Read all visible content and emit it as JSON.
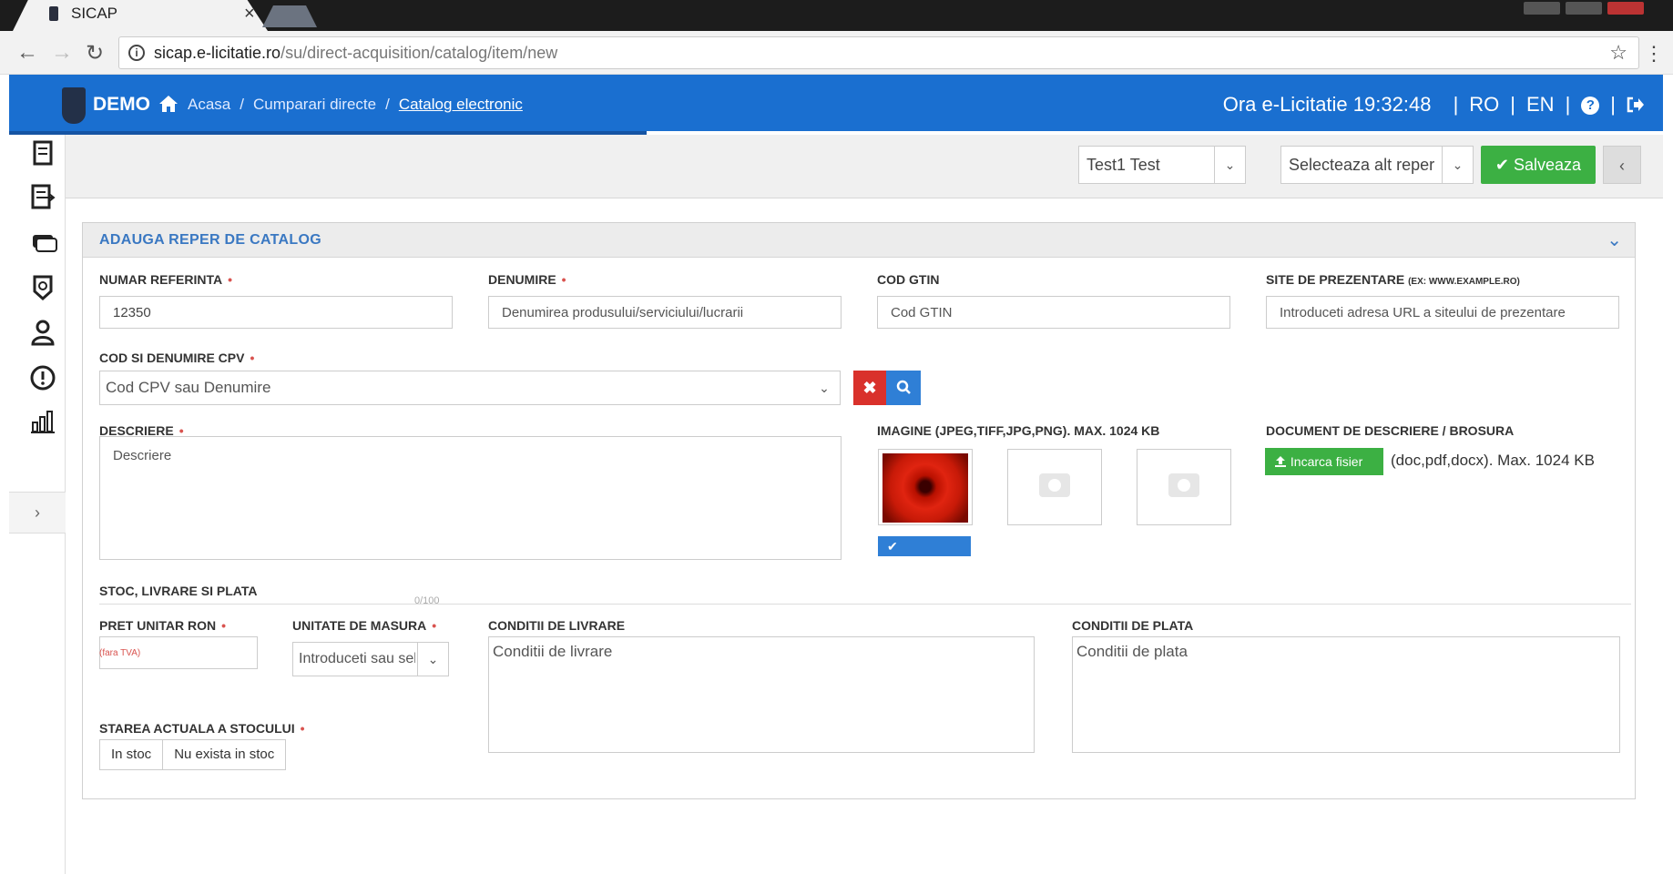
{
  "browser": {
    "tab_title": "SICAP",
    "tab_close": "×",
    "url_host": "sicap.e-licitatie.ro",
    "url_path": "/su/direct-acquisition/catalog/item/new"
  },
  "header": {
    "brand": "DEMO",
    "breadcrumbs": [
      "Acasa",
      "Cumparari directe",
      "Catalog electronic"
    ],
    "breadcrumb_sep": "/",
    "clock_label": "Ora e-Licitatie",
    "clock_time": "19:32:48",
    "lang_ro": "RO",
    "lang_en": "EN",
    "divider": "|",
    "help": "?"
  },
  "toolbar": {
    "user_select": "Test1 Test",
    "reper_select": "Selecteaza alt reper",
    "save_label": "✔ Salveaza",
    "collapse_label": "‹"
  },
  "panel": {
    "title": "ADAUGA REPER DE CATALOG",
    "chevron": "⌄"
  },
  "form": {
    "numar_referinta": {
      "label": "NUMAR REFERINTA",
      "value": "12350"
    },
    "denumire": {
      "label": "DENUMIRE",
      "placeholder": "Denumirea produsului/serviciului/lucrarii"
    },
    "cod_gtin": {
      "label": "COD GTIN",
      "placeholder": "Cod GTIN"
    },
    "site": {
      "label": "SITE DE PREZENTARE",
      "hint": "(EX: WWW.EXAMPLE.RO)",
      "placeholder": "Introduceti adresa URL a siteului de prezentare"
    },
    "cpv": {
      "label": "COD SI DENUMIRE CPV",
      "placeholder": "Cod CPV sau Denumire",
      "clear": "✖"
    },
    "descriere": {
      "label": "DESCRIERE",
      "placeholder": "Descriere"
    },
    "imagine": {
      "label": "IMAGINE (JPEG,TIFF,JPG,PNG). MAX. 1024 KB",
      "check": "✔"
    },
    "document": {
      "label": "DOCUMENT DE DESCRIERE / BROSURA",
      "upload_label": "Incarca fisier",
      "note": "(doc,pdf,docx). Max. 1024 KB"
    },
    "section_stoc": "STOC, LIVRARE SI PLATA",
    "pret": {
      "label": "PRET UNITAR RON",
      "hint": "(fara TVA)"
    },
    "unitate": {
      "label": "UNITATE DE MASURA",
      "placeholder": "Introduceti sau selectati",
      "counter": "0/100"
    },
    "conditii_livrare": {
      "label": "CONDITII DE LIVRARE",
      "placeholder": "Conditii de livrare"
    },
    "conditii_plata": {
      "label": "CONDITII DE PLATA",
      "placeholder": "Conditii de plata"
    },
    "stoc": {
      "label": "STAREA ACTUALA A STOCULUI",
      "options": [
        "In stoc",
        "Nu exista in stoc"
      ]
    },
    "required_mark": "•"
  },
  "colors": {
    "header_blue": "#1a6fd0",
    "save_green": "#3cb043",
    "danger_red": "#d9312b",
    "title_blue": "#3a78c2"
  },
  "icons": [
    "back-icon",
    "forward-icon",
    "reload-icon",
    "info-icon",
    "star-icon",
    "home-icon",
    "help-icon",
    "logout-icon",
    "search-icon",
    "upload-icon",
    "camera-icon"
  ]
}
